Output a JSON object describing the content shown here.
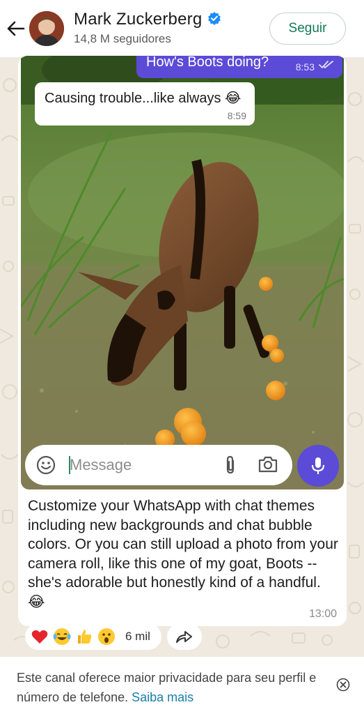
{
  "header": {
    "title": "Mark Zuckerberg",
    "subtitle": "14,8 M seguidores",
    "follow_label": "Seguir",
    "verified_color": "#1a8cff"
  },
  "photo_chat": {
    "outgoing_text": "How's Boots doing?",
    "outgoing_time": "8:53",
    "incoming_text": "Causing trouble...like always 😂",
    "incoming_time": "8:59"
  },
  "composer": {
    "placeholder": "Message"
  },
  "message": {
    "caption": "Customize your WhatsApp with chat themes including new backgrounds and chat bubble colors. Or you can still upload a photo from your camera roll, like this one of my goat, Boots -- she's adorable but honestly kind of a handful. 😂",
    "time": "13:00"
  },
  "reactions": {
    "emojis": [
      "heart",
      "tears-of-joy",
      "thumbs-up",
      "surprised"
    ],
    "count": "6 mil"
  },
  "footer": {
    "text": "Este canal oferece maior privacidade para seu perfil e número de telefone.",
    "link": "Saiba mais"
  },
  "colors": {
    "accent": "#5b4bd6",
    "follow_text": "#127a56",
    "link": "#1a7fa6"
  }
}
